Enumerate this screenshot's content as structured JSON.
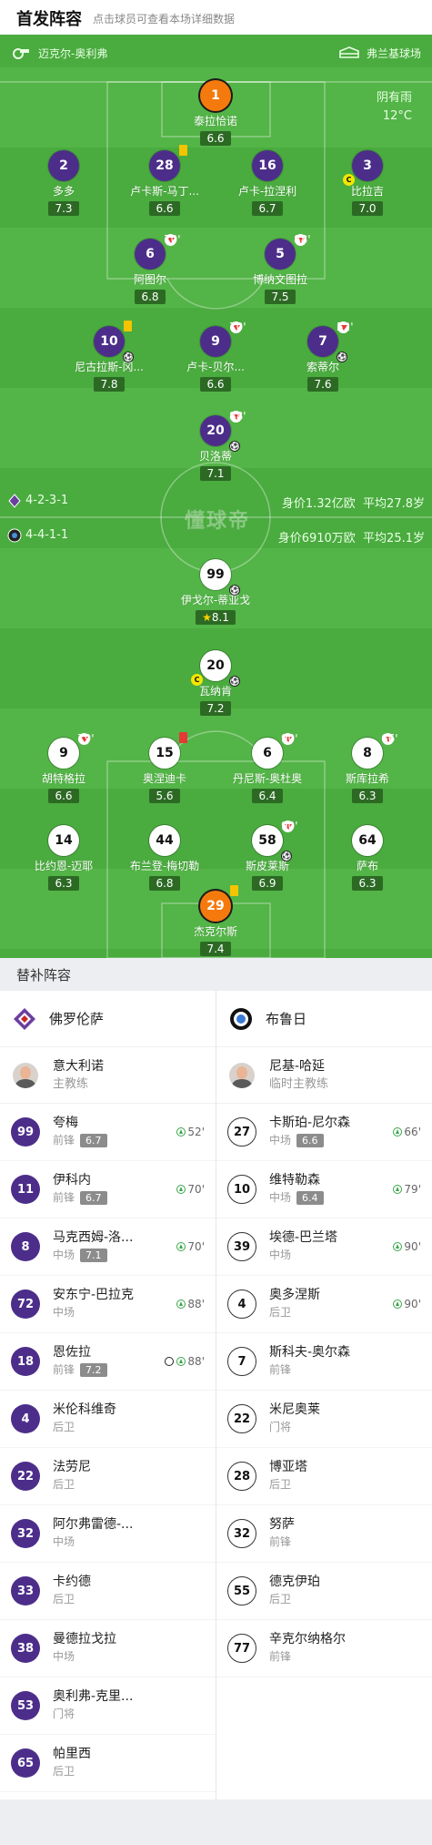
{
  "header": {
    "title": "首发阵容",
    "subtitle": "点击球员可查看本场详细数据"
  },
  "pitch": {
    "referee": "迈克尔-奥利弗",
    "stadium": "弗兰基球场",
    "weather": "阴有雨",
    "temperature": "12°C",
    "home_formation": "4-2-3-1",
    "away_formation": "4-4-1-1",
    "home_value": "身价1.32亿欧",
    "home_age": "平均27.8岁",
    "away_value": "身价6910万欧",
    "away_age": "平均25.1岁",
    "watermark": "懂球帝",
    "colors": {
      "home": "#4c2e8a",
      "away": "#ffffff",
      "pitch": "#4aab3f",
      "best_rating": "#f57a0d"
    }
  },
  "players": [
    {
      "num": "1",
      "name": "泰拉恰诺",
      "rating": "6.6"
    },
    {
      "num": "2",
      "name": "多多",
      "rating": "7.3"
    },
    {
      "num": "28",
      "name": "卢卡斯-马丁...",
      "rating": "6.6"
    },
    {
      "num": "16",
      "name": "卢卡-拉涅利",
      "rating": "6.7"
    },
    {
      "num": "3",
      "name": "比拉吉",
      "rating": "7.0"
    },
    {
      "num": "6",
      "name": "阿图尔",
      "rating": "6.8",
      "sub": "70'"
    },
    {
      "num": "5",
      "name": "博纳文图拉",
      "rating": "7.5",
      "sub": "88'"
    },
    {
      "num": "10",
      "name": "尼古拉斯-冈...",
      "rating": "7.8"
    },
    {
      "num": "9",
      "name": "卢卡-贝尔...",
      "rating": "6.6",
      "sub": "70'"
    },
    {
      "num": "7",
      "name": "索蒂尔",
      "rating": "7.6",
      "sub": "52'"
    },
    {
      "num": "20",
      "name": "贝洛蒂",
      "rating": "7.1",
      "sub": "88'"
    },
    {
      "num": "99",
      "name": "伊戈尔-蒂亚戈",
      "rating": "8.1"
    },
    {
      "num": "20",
      "name": "瓦纳肯",
      "rating": "7.2"
    },
    {
      "num": "9",
      "name": "胡特格拉",
      "rating": "6.6",
      "sub": "79'"
    },
    {
      "num": "15",
      "name": "奥涅迪卡",
      "rating": "5.6"
    },
    {
      "num": "6",
      "name": "丹尼斯-奥杜奥",
      "rating": "6.4",
      "sub": "90'"
    },
    {
      "num": "8",
      "name": "斯库拉希",
      "rating": "6.3",
      "sub": "66'"
    },
    {
      "num": "14",
      "name": "比约恩-迈耶",
      "rating": "6.3"
    },
    {
      "num": "44",
      "name": "布兰登-梅切勒",
      "rating": "6.8"
    },
    {
      "num": "58",
      "name": "斯皮莱斯",
      "rating": "6.9",
      "sub": "90'"
    },
    {
      "num": "64",
      "name": "萨布",
      "rating": "6.3"
    },
    {
      "num": "29",
      "name": "杰克尔斯",
      "rating": "7.4"
    }
  ],
  "subs": {
    "heading": "替补阵容",
    "home": {
      "team": "佛罗伦萨",
      "coach_name": "意大利诺",
      "coach_role": "主教练",
      "list": [
        {
          "num": "99",
          "name": "夸梅",
          "pos": "前锋",
          "rating": "6.7",
          "in": "52'"
        },
        {
          "num": "11",
          "name": "伊科内",
          "pos": "前锋",
          "rating": "6.7",
          "in": "70'"
        },
        {
          "num": "8",
          "name": "马克西姆-洛...",
          "pos": "中场",
          "rating": "7.1",
          "in": "70'"
        },
        {
          "num": "72",
          "name": "安东宁-巴拉克",
          "pos": "中场",
          "rating": "",
          "in": "88'"
        },
        {
          "num": "18",
          "name": "恩佐拉",
          "pos": "前锋",
          "rating": "7.2",
          "in": "88'"
        },
        {
          "num": "4",
          "name": "米伦科维奇",
          "pos": "后卫",
          "rating": "",
          "in": ""
        },
        {
          "num": "22",
          "name": "法劳尼",
          "pos": "后卫",
          "rating": "",
          "in": ""
        },
        {
          "num": "32",
          "name": "阿尔弗雷德-...",
          "pos": "中场",
          "rating": "",
          "in": ""
        },
        {
          "num": "33",
          "name": "卡约德",
          "pos": "后卫",
          "rating": "",
          "in": ""
        },
        {
          "num": "38",
          "name": "曼德拉戈拉",
          "pos": "中场",
          "rating": "",
          "in": ""
        },
        {
          "num": "53",
          "name": "奥利弗-克里...",
          "pos": "门将",
          "rating": "",
          "in": ""
        },
        {
          "num": "65",
          "name": "帕里西",
          "pos": "后卫",
          "rating": "",
          "in": ""
        }
      ]
    },
    "away": {
      "team": "布鲁日",
      "coach_name": "尼基-哈延",
      "coach_role": "临时主教练",
      "list": [
        {
          "num": "27",
          "name": "卡斯珀-尼尔森",
          "pos": "中场",
          "rating": "6.6",
          "in": "66'"
        },
        {
          "num": "10",
          "name": "维特勒森",
          "pos": "中场",
          "rating": "6.4",
          "in": "79'"
        },
        {
          "num": "39",
          "name": "埃德-巴兰塔",
          "pos": "中场",
          "rating": "",
          "in": "90'"
        },
        {
          "num": "4",
          "name": "奥多涅斯",
          "pos": "后卫",
          "rating": "",
          "in": "90'"
        },
        {
          "num": "7",
          "name": "斯科夫-奥尔森",
          "pos": "前锋",
          "rating": "",
          "in": ""
        },
        {
          "num": "22",
          "name": "米尼奥莱",
          "pos": "门将",
          "rating": "",
          "in": ""
        },
        {
          "num": "28",
          "name": "博亚塔",
          "pos": "后卫",
          "rating": "",
          "in": ""
        },
        {
          "num": "32",
          "name": "努萨",
          "pos": "前锋",
          "rating": "",
          "in": ""
        },
        {
          "num": "55",
          "name": "德克伊珀",
          "pos": "后卫",
          "rating": "",
          "in": ""
        },
        {
          "num": "77",
          "name": "辛克尔纳格尔",
          "pos": "前锋",
          "rating": "",
          "in": ""
        }
      ]
    }
  }
}
